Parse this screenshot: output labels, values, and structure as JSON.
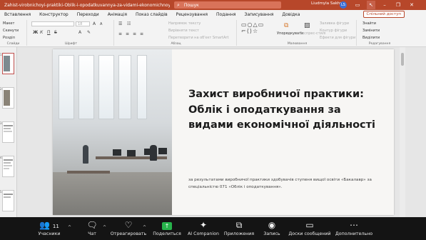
{
  "window": {
    "title": "Zahist-virobnichoyi-praktiki-Oblik-i-opodatkuvannya-za-vidami-ekonomichnoyi-diyalnosti - PowerPoint",
    "search_placeholder": "Пошук",
    "user_name": "Liudmyla Sakhno",
    "user_initials": "LS"
  },
  "tabs": [
    "Вставлення",
    "Конструктор",
    "Переходи",
    "Анімація",
    "Показ слайдів",
    "Рецензування",
    "Подання",
    "Записування",
    "Довідка"
  ],
  "share_button": "Спільний доступ",
  "ribbon": {
    "slides_group": {
      "items": [
        "Макет",
        "Скинути",
        "Розділ"
      ],
      "label": "Слайди"
    },
    "font_group": {
      "label": "Шрифт",
      "size": "18"
    },
    "paragraph_group": {
      "items": [
        "Напрямок тексту",
        "Вирівняти текст",
        "Перетворити на об'єкт SmartArt"
      ],
      "label": "Абзац"
    },
    "drawing_group": {
      "items": [
        "Упорядкувати",
        "Експрес-стилі",
        "Заливка фігури",
        "Контур фігури",
        "Ефекти для фігури"
      ],
      "label": "Малювання"
    },
    "editing_group": {
      "items": [
        "Знайти",
        "Замінити",
        "Виділити"
      ],
      "label": "Редагування"
    }
  },
  "thumbnails": {
    "numbers": [
      "1",
      "2",
      "3",
      "4",
      "5"
    ]
  },
  "slide": {
    "title": "Захист виробничої практики: Облік і оподаткування за видами економічної діяльності",
    "subtitle": "за результатами виробничої практики здобувачів ступеня вищої освіти «Бакалавр» за спеціальністю 071 «Облік і оподаткування»."
  },
  "meeting_bar": {
    "participants": {
      "label": "Учасники",
      "count": "11"
    },
    "chat": "Чат",
    "react": "Отреагировать",
    "share": "Поделиться",
    "ai": "AI Companion",
    "apps": "Приложения",
    "record": "Запись",
    "whiteboards": "Доски сообщений",
    "more": "Дополнительно"
  }
}
